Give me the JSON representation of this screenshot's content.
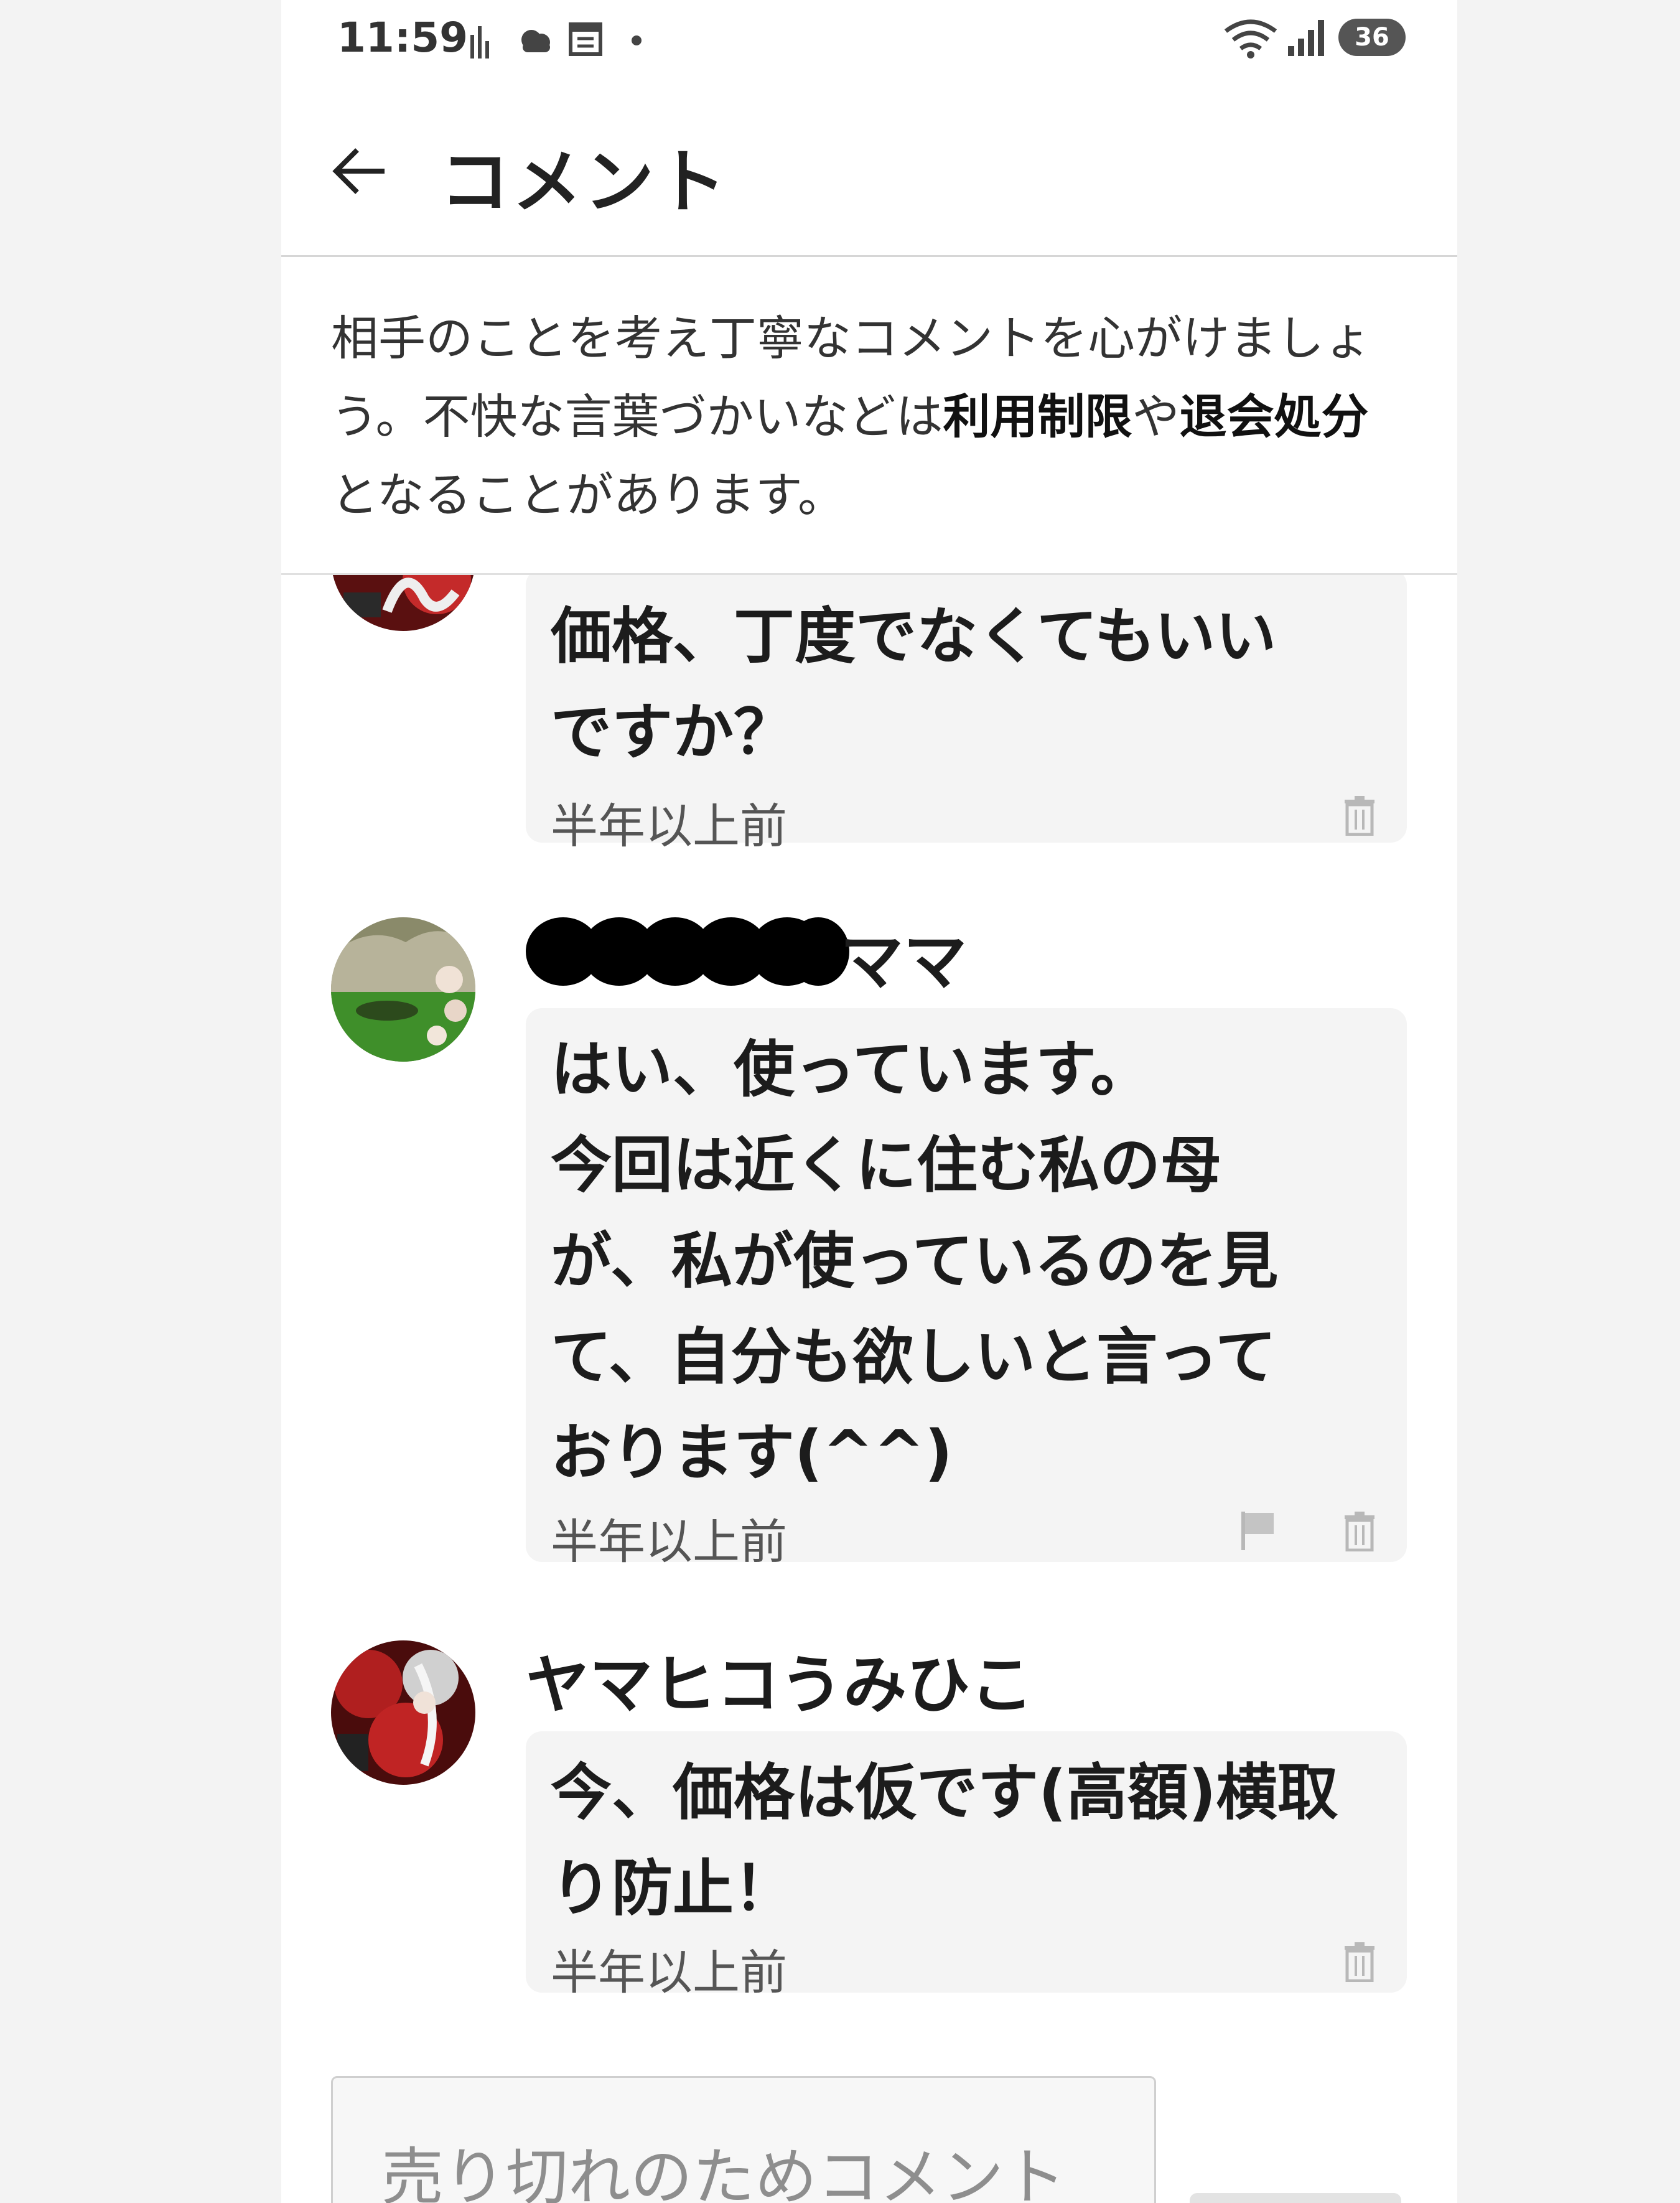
{
  "status_bar": {
    "time": "11:59",
    "battery": "36",
    "left_icons": [
      "signal-bars-icon",
      "weather-icon",
      "news-icon",
      "dot-icon"
    ],
    "right_icons": [
      "wifi-icon",
      "cell-signal-icon",
      "battery-icon"
    ]
  },
  "header": {
    "back_icon": "arrow-left-icon",
    "title": "コメント"
  },
  "notice": {
    "text_part1": "相手のことを考え丁寧なコメントを心がけましょう。不快な言葉づかいなどは",
    "bold1": "利用制限",
    "text_part2": "や",
    "bold2": "退会処分",
    "text_part3": "となることがあります。"
  },
  "comments": [
    {
      "author": "",
      "text": "価格、丁度でなくてもいい\nですか？",
      "time": "半年以上前",
      "icons": [
        "trash-icon"
      ]
    },
    {
      "author": "ママ",
      "author_redacted": true,
      "text": "はい、使っています。\n今回は近くに住む私の母\nが、私が使っているのを見\nて、自分も欲しいと言って\nおります(^^)",
      "time": "半年以上前",
      "icons": [
        "flag-icon",
        "trash-icon"
      ]
    },
    {
      "author": "ヤマヒコうみひこ",
      "text": "今、価格は仮です(高額)横取\nり防止！",
      "time": "半年以上前",
      "icons": [
        "trash-icon"
      ]
    }
  ],
  "comment_input": {
    "placeholder": "売り切れのためコメント"
  },
  "colors": {
    "bubble": "#f4f4f4",
    "background": "#ffffff",
    "divider": "#d6d6d6"
  }
}
